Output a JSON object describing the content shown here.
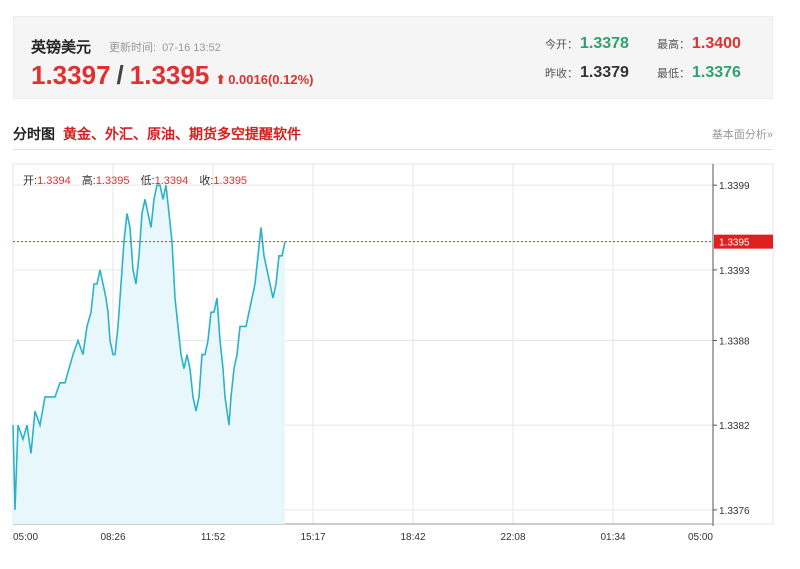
{
  "quote": {
    "name": "英镑美元",
    "update_label": "更新时间:",
    "update_time": "07-16 13:52",
    "bid": "1.3397",
    "separator": "/",
    "ask": "1.3395",
    "change_arrow": "arrow-up-icon",
    "change": "0.0016(0.12%)",
    "stats": {
      "open_label": "今开：",
      "open": "1.3378",
      "high_label": "最高：",
      "high": "1.3400",
      "prev_close_label": "昨收：",
      "prev_close": "1.3379",
      "low_label": "最低：",
      "low": "1.3376"
    }
  },
  "section": {
    "title": "分时图",
    "promo_link": "黄金、外汇、原油、期货多空提醒软件",
    "right_link": "基本面分析»"
  },
  "ohlc": {
    "open_label": "开:",
    "open": "1.3394",
    "high_label": "高:",
    "high": "1.3395",
    "low_label": "低:",
    "low": "1.3394",
    "close_label": "收:",
    "close": "1.3395"
  },
  "colors": {
    "line": "#2ab3c8",
    "fill": "#e8f7fb",
    "up": "#e03030",
    "down": "#2fa06e",
    "grid": "#e6e6e6",
    "current_price_tag": "#e02020"
  },
  "chart_data": {
    "type": "area",
    "x_ticks": [
      "05:00",
      "08:26",
      "11:52",
      "15:17",
      "18:42",
      "22:08",
      "01:34",
      "05:00"
    ],
    "y_ticks": [
      "1.3399",
      "1.3393",
      "1.3388",
      "1.3382",
      "1.3376"
    ],
    "current_price": "1.3395",
    "ylim": [
      1.3375,
      1.34005
    ],
    "points": [
      [
        0,
        1.3382
      ],
      [
        0.02,
        1.3376
      ],
      [
        0.05,
        1.3382
      ],
      [
        0.1,
        1.3381
      ],
      [
        0.14,
        1.3382
      ],
      [
        0.18,
        1.338
      ],
      [
        0.22,
        1.3383
      ],
      [
        0.27,
        1.3382
      ],
      [
        0.32,
        1.3384
      ],
      [
        0.37,
        1.3384
      ],
      [
        0.42,
        1.3384
      ],
      [
        0.47,
        1.3385
      ],
      [
        0.52,
        1.3385
      ],
      [
        0.56,
        1.3386
      ],
      [
        0.6,
        1.3387
      ],
      [
        0.65,
        1.3388
      ],
      [
        0.7,
        1.3387
      ],
      [
        0.74,
        1.3389
      ],
      [
        0.78,
        1.339
      ],
      [
        0.81,
        1.3392
      ],
      [
        0.84,
        1.3392
      ],
      [
        0.87,
        1.3393
      ],
      [
        0.9,
        1.3392
      ],
      [
        0.93,
        1.3391
      ],
      [
        0.95,
        1.339
      ],
      [
        0.97,
        1.3388
      ],
      [
        1.0,
        1.3387
      ],
      [
        1.02,
        1.3387
      ],
      [
        1.05,
        1.3389
      ],
      [
        1.08,
        1.3392
      ],
      [
        1.11,
        1.3395
      ],
      [
        1.14,
        1.3397
      ],
      [
        1.17,
        1.3396
      ],
      [
        1.2,
        1.3393
      ],
      [
        1.23,
        1.3392
      ],
      [
        1.26,
        1.3394
      ],
      [
        1.29,
        1.3397
      ],
      [
        1.32,
        1.3398
      ],
      [
        1.35,
        1.3397
      ],
      [
        1.38,
        1.3396
      ],
      [
        1.41,
        1.3398
      ],
      [
        1.44,
        1.3399
      ],
      [
        1.47,
        1.3399
      ],
      [
        1.5,
        1.3398
      ],
      [
        1.53,
        1.3399
      ],
      [
        1.56,
        1.3397
      ],
      [
        1.59,
        1.3395
      ],
      [
        1.62,
        1.3391
      ],
      [
        1.65,
        1.3389
      ],
      [
        1.68,
        1.3387
      ],
      [
        1.71,
        1.3386
      ],
      [
        1.74,
        1.3387
      ],
      [
        1.77,
        1.3386
      ],
      [
        1.8,
        1.3384
      ],
      [
        1.83,
        1.3383
      ],
      [
        1.86,
        1.3384
      ],
      [
        1.89,
        1.3387
      ],
      [
        1.92,
        1.3387
      ],
      [
        1.95,
        1.3388
      ],
      [
        1.98,
        1.339
      ],
      [
        2.01,
        1.339
      ],
      [
        2.04,
        1.3391
      ],
      [
        2.07,
        1.3388
      ],
      [
        2.1,
        1.3386
      ],
      [
        2.12,
        1.3384
      ],
      [
        2.14,
        1.3383
      ],
      [
        2.16,
        1.3382
      ],
      [
        2.18,
        1.3384
      ],
      [
        2.21,
        1.3386
      ],
      [
        2.24,
        1.3387
      ],
      [
        2.27,
        1.3389
      ],
      [
        2.3,
        1.3389
      ],
      [
        2.33,
        1.3389
      ],
      [
        2.36,
        1.339
      ],
      [
        2.39,
        1.3391
      ],
      [
        2.42,
        1.3392
      ],
      [
        2.45,
        1.3394
      ],
      [
        2.48,
        1.3396
      ],
      [
        2.51,
        1.3394
      ],
      [
        2.54,
        1.3393
      ],
      [
        2.57,
        1.3392
      ],
      [
        2.6,
        1.3391
      ],
      [
        2.63,
        1.3392
      ],
      [
        2.66,
        1.3394
      ],
      [
        2.69,
        1.3394
      ],
      [
        2.72,
        1.3395
      ]
    ]
  }
}
